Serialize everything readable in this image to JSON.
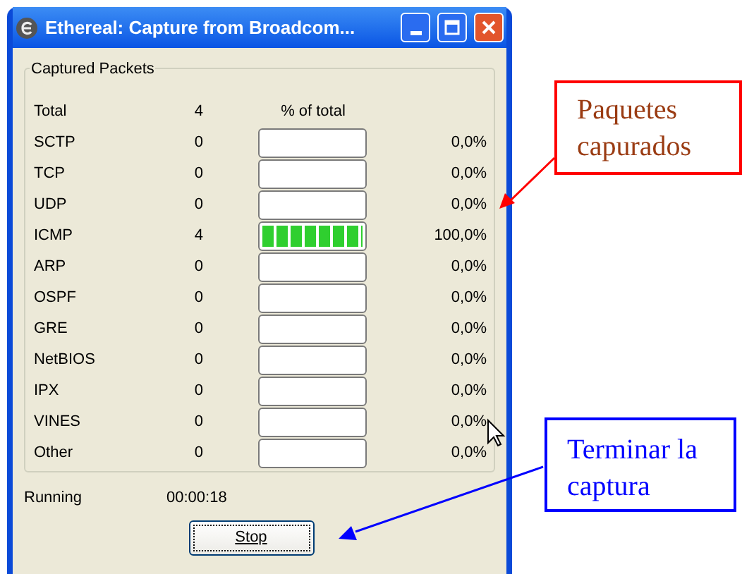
{
  "window": {
    "title": "Ethereal: Capture from Broadcom..."
  },
  "captured_packets": {
    "title": "Captured Packets",
    "total": {
      "label": "Total",
      "count": "4",
      "header": "% of total"
    },
    "rows": [
      {
        "protocol": "SCTP",
        "count": "0",
        "percent": "0,0%"
      },
      {
        "protocol": "TCP",
        "count": "0",
        "percent": "0,0%"
      },
      {
        "protocol": "UDP",
        "count": "0",
        "percent": "0,0%"
      },
      {
        "protocol": "ICMP",
        "count": "4",
        "level": 1,
        "percent": "100,0%"
      },
      {
        "protocol": "ARP",
        "count": "0",
        "percent": "0,0%"
      },
      {
        "protocol": "OSPF",
        "count": "0",
        "percent": "0,0%"
      },
      {
        "protocol": "GRE",
        "count": "0",
        "percent": "0,0%"
      },
      {
        "protocol": "NetBIOS",
        "count": "0",
        "percent": "0,0%"
      },
      {
        "protocol": "IPX",
        "count": "0",
        "percent": "0,0%"
      },
      {
        "protocol": "VINES",
        "count": "0",
        "percent": "0,0%"
      },
      {
        "protocol": "Other",
        "count": "0",
        "percent": "0,0%"
      }
    ]
  },
  "status": {
    "label": "Running",
    "elapsed": "00:00:18"
  },
  "stop_button": {
    "label": "Stop"
  },
  "callouts": [
    {
      "text": "Paquetes capurados",
      "color": "#ff0000"
    },
    {
      "text": "Terminar la captura",
      "color": "#0000ff"
    }
  ]
}
